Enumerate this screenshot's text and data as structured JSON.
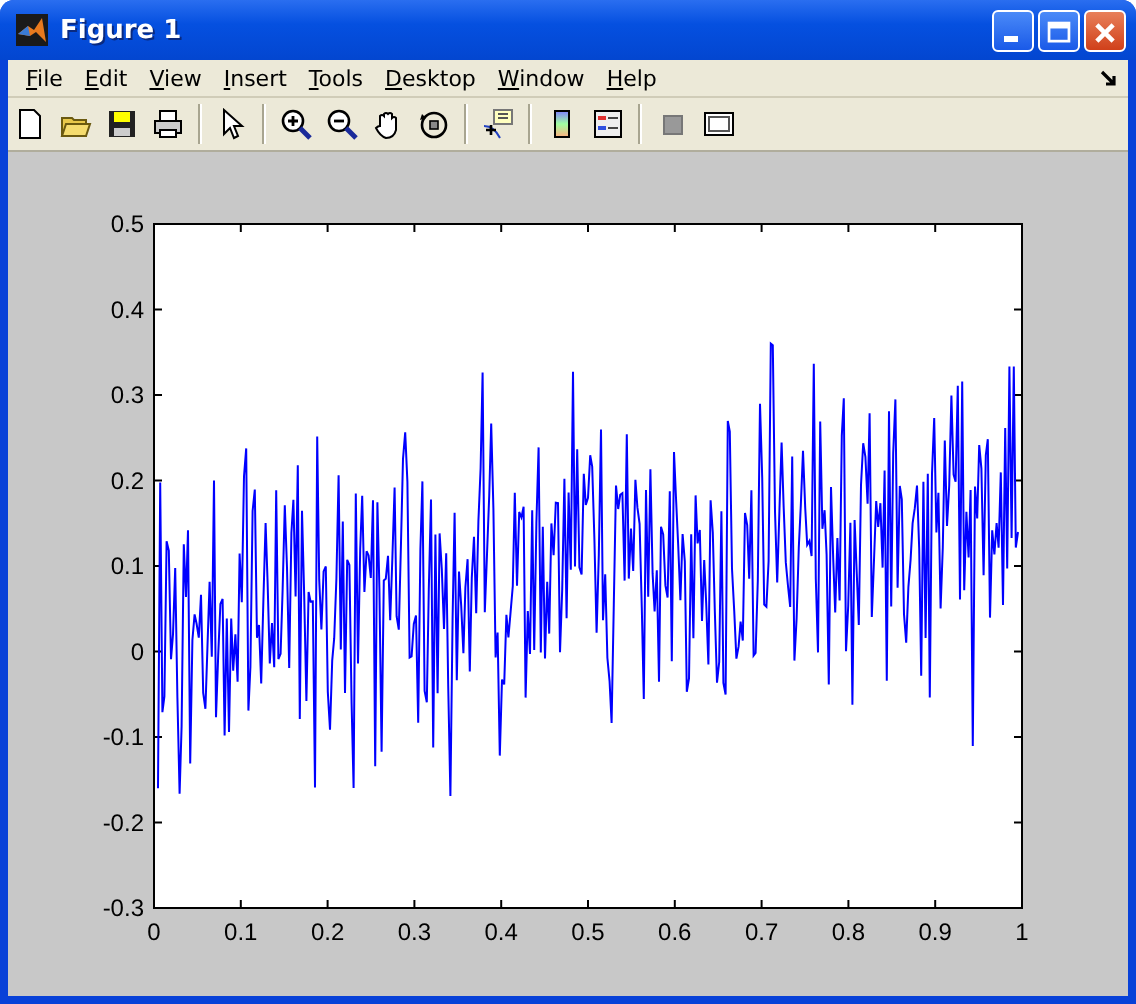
{
  "window": {
    "title": "Figure 1"
  },
  "menu": [
    {
      "label": "File"
    },
    {
      "label": "Edit"
    },
    {
      "label": "View"
    },
    {
      "label": "Insert"
    },
    {
      "label": "Tools"
    },
    {
      "label": "Desktop"
    },
    {
      "label": "Window"
    },
    {
      "label": "Help"
    }
  ],
  "axes": {
    "ytick_labels": [
      "0.5",
      "0.4",
      "0.3",
      "0.2",
      "0.1",
      "0",
      "-0.1",
      "-0.2",
      "-0.3"
    ],
    "xtick_labels": [
      "0",
      "0.1",
      "0.2",
      "0.3",
      "0.4",
      "0.5",
      "0.6",
      "0.7",
      "0.8",
      "0.9",
      "1"
    ]
  }
}
